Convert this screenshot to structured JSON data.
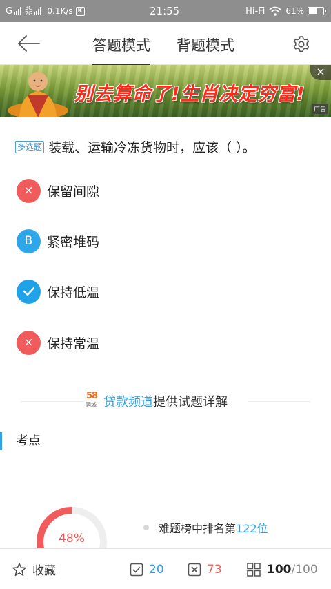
{
  "status_bar": {
    "carrier_g": "G",
    "net_3g": "3G",
    "net_2g": "2G",
    "speed": "0.1K/s",
    "k_badge": "K",
    "time": "21:55",
    "wifi_label": "Hi-Fi",
    "battery": "61%",
    "battery_level": 0.61
  },
  "header": {
    "tabs": [
      {
        "label": "答题模式",
        "active": true
      },
      {
        "label": "背题模式",
        "active": false
      }
    ]
  },
  "ad": {
    "text": "别去算命了!生肖决定穷富!",
    "close": "×",
    "tag": "广告"
  },
  "question": {
    "type": "多选题",
    "text": "装载、运输冷冻货物时，应该（ ）。"
  },
  "options": [
    {
      "marker": "×",
      "label": "保留间隙",
      "state": "wrong"
    },
    {
      "marker": "B",
      "label": "紧密堆码",
      "state": "neutral"
    },
    {
      "marker": "✓",
      "label": "保持低温",
      "state": "right"
    },
    {
      "marker": "×",
      "label": "保持常温",
      "state": "wrong"
    }
  ],
  "provider": {
    "logo_num": "58",
    "logo_sub": "同城",
    "link": "贷款频道",
    "rest": "提供试题详解"
  },
  "section": {
    "title": "考点"
  },
  "stats": {
    "percent_label": "48%",
    "percent_value": 48,
    "rank_prefix": "难题榜中排名第",
    "rank_value": "122位"
  },
  "bottom_bar": {
    "favorite": "收藏",
    "correct_count": "20",
    "wrong_count": "73",
    "progress_current": "100",
    "progress_sep": "/",
    "progress_total": "100"
  },
  "colors": {
    "accent": "#2fa6ea",
    "wrong": "#f05c5c",
    "status_bar": "#8e8e8e"
  }
}
